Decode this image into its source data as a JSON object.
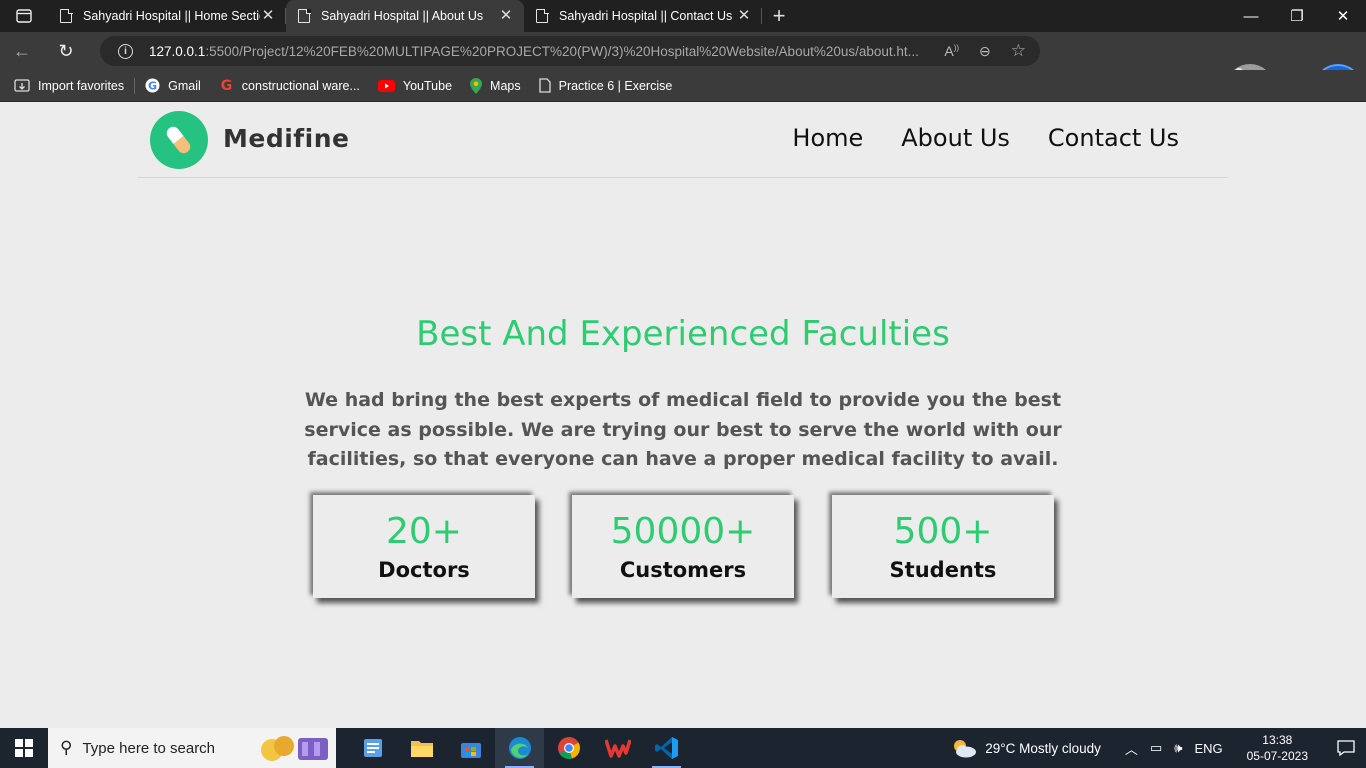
{
  "browser": {
    "tabs": [
      {
        "title": "Sahyadri Hospital || Home Section"
      },
      {
        "title": "Sahyadri Hospital || About Us"
      },
      {
        "title": "Sahyadri Hospital || Contact Us"
      }
    ],
    "url_host": "127.0.0.1",
    "url_path": ":5500/Project/12%20FEB%20MULTIPAGE%20PROJECT%20(PW)/3)%20Hospital%20Website/About%20us/about.ht...",
    "favorites": [
      {
        "label": "Import favorites",
        "icon": "import-icon"
      },
      {
        "label": "Gmail",
        "icon": "google-icon"
      },
      {
        "label": "constructional ware...",
        "icon": "google-icon"
      },
      {
        "label": "YouTube",
        "icon": "youtube-icon"
      },
      {
        "label": "Maps",
        "icon": "maps-icon"
      },
      {
        "label": "Practice 6 | Exercise",
        "icon": "page-icon"
      }
    ]
  },
  "site": {
    "brand": "Medifine",
    "nav": [
      "Home",
      "About Us",
      "Contact Us"
    ],
    "heading": "Best And Experienced Faculties",
    "description": "We had bring the best experts of medical field to provide you the best service as possible. We are trying our best to serve the world with our facilities, so that everyone can have a proper medical facility to avail.",
    "stats": [
      {
        "value": "20+",
        "label": "Doctors"
      },
      {
        "value": "50000+",
        "label": "Customers"
      },
      {
        "value": "500+",
        "label": "Students"
      }
    ],
    "colors": {
      "accent": "#2ecc71",
      "logo": "#26c281"
    }
  },
  "taskbar": {
    "search_placeholder": "Type here to search",
    "weather": "29°C  Mostly cloudy",
    "lang": "ENG",
    "time": "13:38",
    "date": "05-07-2023"
  }
}
